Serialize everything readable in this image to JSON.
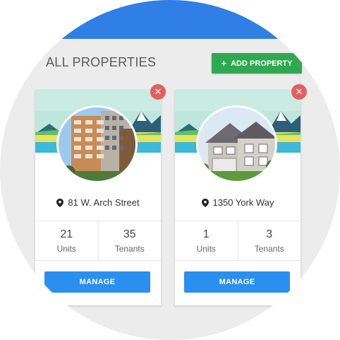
{
  "header": {
    "title": "ALL PROPERTIES",
    "add_button_icon": "plus-icon",
    "add_button_label": "ADD PROPERTY"
  },
  "colors": {
    "topbar": "#2f7fe6",
    "add_button": "#2fa84f",
    "manage_button": "#2a8ff0",
    "close_button": "#e45f5f"
  },
  "properties": [
    {
      "address": "81 W. Arch Street",
      "units_value": "21",
      "units_label": "Units",
      "tenants_value": "35",
      "tenants_label": "Tenants",
      "manage_label": "MANAGE"
    },
    {
      "address": "1350 York Way",
      "units_value": "1",
      "units_label": "Units",
      "tenants_value": "3",
      "tenants_label": "Tenants",
      "manage_label": "MANAGE"
    }
  ]
}
